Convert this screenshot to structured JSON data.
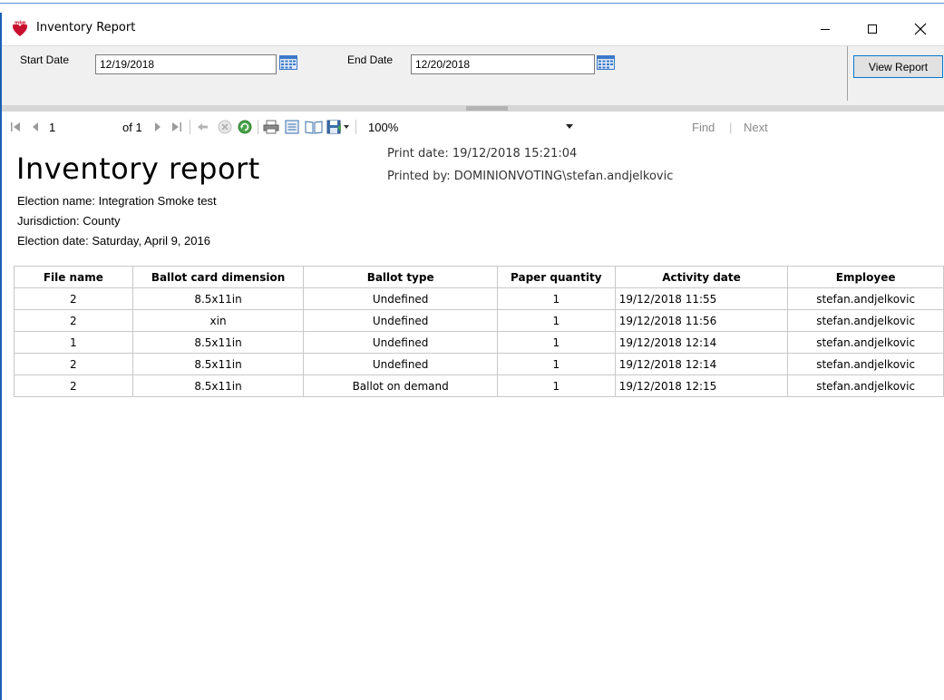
{
  "window": {
    "title": "Inventory Report"
  },
  "params": {
    "start_label": "Start Date",
    "start_value": "12/19/2018",
    "end_label": "End Date",
    "end_value": "12/20/2018",
    "view_report_label": "View Report"
  },
  "toolbar": {
    "page_current": "1",
    "page_of": "of 1",
    "zoom": "100%",
    "find_label": "Find",
    "find_sep": "|",
    "next_label": "Next"
  },
  "report": {
    "title": "Inventory report",
    "print_date": "Print date: 19/12/2018 15:21:04",
    "printed_by": "Printed by: DOMINIONVOTING\\stefan.andjelkovic",
    "election_name": "Election name: Integration Smoke test",
    "jurisdiction": "Jurisdiction: County",
    "election_date": "Election date: Saturday, April 9, 2016",
    "columns": [
      "File name",
      "Ballot card dimension",
      "Ballot type",
      "Paper quantity",
      "Activity date",
      "Employee"
    ],
    "rows": [
      [
        "2",
        "8.5x11in",
        "Undefined",
        "1",
        "19/12/2018 11:55",
        "stefan.andjelkovic"
      ],
      [
        "2",
        "xin",
        "Undefined",
        "1",
        "19/12/2018 11:56",
        "stefan.andjelkovic"
      ],
      [
        "1",
        "8.5x11in",
        "Undefined",
        "1",
        "19/12/2018 12:14",
        "stefan.andjelkovic"
      ],
      [
        "2",
        "8.5x11in",
        "Undefined",
        "1",
        "19/12/2018 12:14",
        "stefan.andjelkovic"
      ],
      [
        "2",
        "8.5x11in",
        "Ballot on demand",
        "1",
        "19/12/2018 12:15",
        "stefan.andjelkovic"
      ]
    ]
  },
  "icons": {
    "app": "mbp-app-icon",
    "calendar": "calendar-icon",
    "first_page": "first-page-icon",
    "prev_page": "previous-page-icon",
    "next_page": "next-page-icon",
    "last_page": "last-page-icon",
    "back": "back-icon",
    "stop": "stop-icon",
    "refresh": "refresh-icon",
    "print": "print-icon",
    "print_layout": "print-layout-icon",
    "page_setup": "page-setup-icon",
    "export": "export-icon"
  },
  "colors": {
    "accent": "#0078d7",
    "app_icon": "#c8102e",
    "calendar": "#3c78c8"
  }
}
